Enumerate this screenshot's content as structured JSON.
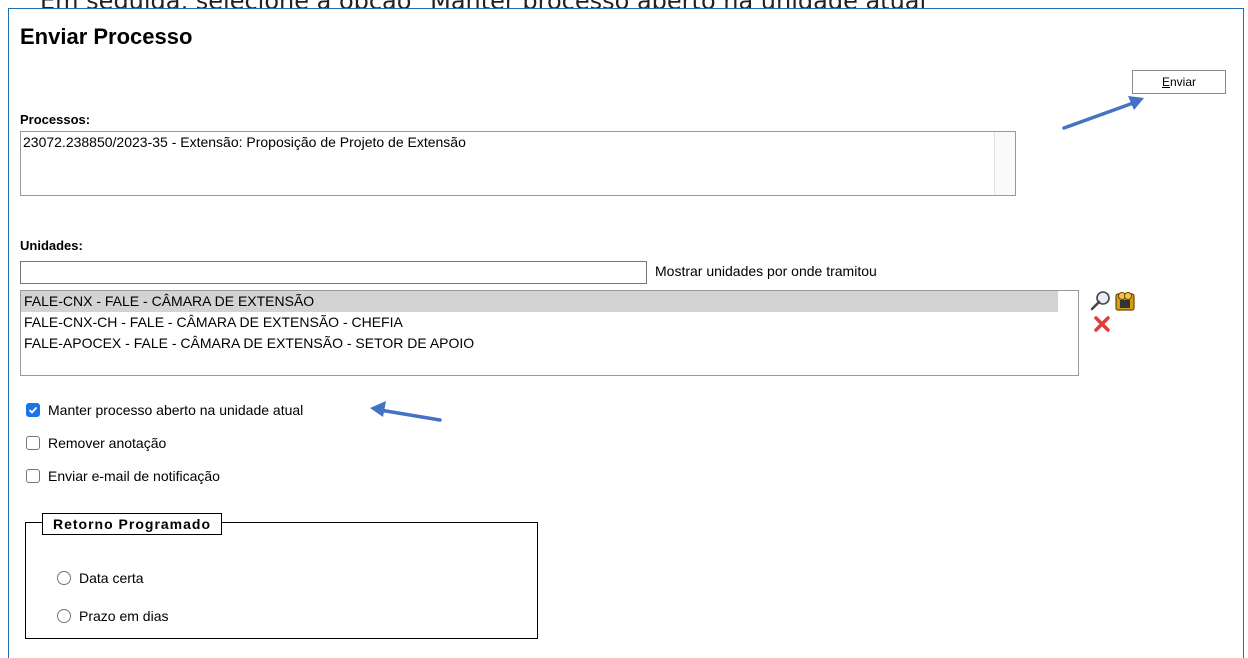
{
  "caption": "Em seguida, selecione a opção \"Manter processo aberto na unidade atual\"",
  "page_title": "Enviar Processo",
  "actions": {
    "send_button_accesskey": "E",
    "send_button_rest": "nviar"
  },
  "processos": {
    "label": "Processos:",
    "items": [
      "23072.238850/2023-35 - Extensão: Proposição de Projeto de Extensão"
    ]
  },
  "unidades": {
    "label": "Unidades:",
    "search_value": "",
    "show_units_link": "Mostrar unidades por onde tramitou",
    "items": [
      {
        "label": "FALE-CNX - FALE - CÂMARA DE EXTENSÃO",
        "selected": true
      },
      {
        "label": "FALE-CNX-CH - FALE - CÂMARA DE EXTENSÃO - CHEFIA",
        "selected": false
      },
      {
        "label": "FALE-APOCEX - FALE - CÂMARA DE EXTENSÃO - SETOR DE APOIO",
        "selected": false
      }
    ],
    "icons": [
      "magnifier-icon",
      "organization-icon",
      "remove-x-icon"
    ]
  },
  "options": [
    {
      "label": "Manter processo aberto na unidade atual",
      "checked": true
    },
    {
      "label": "Remover anotação",
      "checked": false
    },
    {
      "label": "Enviar e-mail de notificação",
      "checked": false
    }
  ],
  "retorno": {
    "legend": "Retorno Programado",
    "options": [
      "Data certa",
      "Prazo em dias"
    ]
  },
  "colors": {
    "arrow": "#4472c4",
    "frame": "#1f6fb5",
    "checkbox": "#1a73e8",
    "selected_row": "#d3d3d3"
  }
}
